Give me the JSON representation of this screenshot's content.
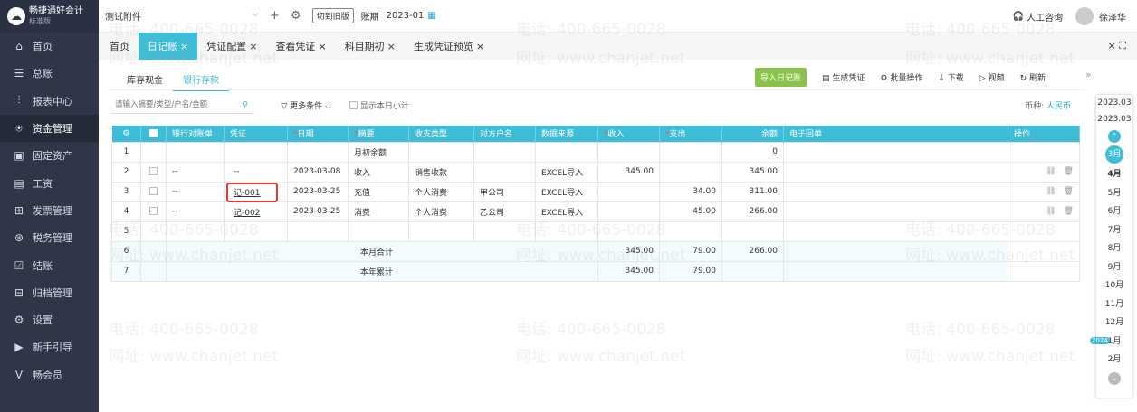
{
  "logo": {
    "title": "畅捷通好会计",
    "subtitle": "标准版"
  },
  "sidebar": {
    "items": [
      {
        "label": "首页",
        "icon": "home-icon"
      },
      {
        "label": "总账",
        "icon": "ledger-icon"
      },
      {
        "label": "报表中心",
        "icon": "chart-icon"
      },
      {
        "label": "资金管理",
        "icon": "money-bag-icon"
      },
      {
        "label": "固定资产",
        "icon": "asset-icon"
      },
      {
        "label": "工资",
        "icon": "salary-icon"
      },
      {
        "label": "发票管理",
        "icon": "invoice-icon"
      },
      {
        "label": "税务管理",
        "icon": "tax-icon"
      },
      {
        "label": "结账",
        "icon": "close-books-icon"
      },
      {
        "label": "归档管理",
        "icon": "archive-icon"
      },
      {
        "label": "设置",
        "icon": "gear-icon"
      },
      {
        "label": "新手引导",
        "icon": "guide-icon"
      },
      {
        "label": "畅会员",
        "icon": "vip-icon"
      }
    ]
  },
  "topbar": {
    "account": "测试附件",
    "switch_label": "切到旧版",
    "period_label": "账期",
    "period_value": "2023-01",
    "support": "人工咨询",
    "username": "徐泽华"
  },
  "tabs": [
    {
      "label": "首页"
    },
    {
      "label": "日记账"
    },
    {
      "label": "凭证配置"
    },
    {
      "label": "查看凭证"
    },
    {
      "label": "科目期初"
    },
    {
      "label": "生成凭证预览"
    }
  ],
  "tab_close": "×",
  "tabs_right": "×  ⛶",
  "subtabs": [
    "库存现金",
    "银行存款"
  ],
  "actions": {
    "import": "导入日记账",
    "generate": "生成凭证",
    "batch": "批量操作",
    "download": "下载",
    "video": "视频",
    "refresh": "刷新"
  },
  "filter": {
    "search_placeholder": "请输入摘要/类型/户名/金额",
    "more": "更多条件",
    "show_subtotal": "显示本日小计",
    "currency_label": "币种:",
    "currency_value": "人民币"
  },
  "table": {
    "headers": [
      "银行对账单",
      "凭证",
      "日期",
      "摘要",
      "收支类型",
      "对方户名",
      "数据来源",
      "收入",
      "支出",
      "余额",
      "电子回单",
      "操作"
    ],
    "rows": [
      {
        "no": "1",
        "bank": "",
        "voucher": "",
        "date": "",
        "summary": "月初余额",
        "type": "",
        "counter": "",
        "source": "",
        "income": "",
        "expense": "",
        "balance": "0"
      },
      {
        "no": "2",
        "bank": "--",
        "voucher": "--",
        "date": "2023-03-08",
        "summary": "收入",
        "type": "销售收款",
        "counter": "",
        "source": "EXCEL导入",
        "income": "345.00",
        "expense": "",
        "balance": "345.00"
      },
      {
        "no": "3",
        "bank": "--",
        "voucher": "记-001",
        "date": "2023-03-25",
        "summary": "充值",
        "type": "个人消费",
        "counter": "甲公司",
        "source": "EXCEL导入",
        "income": "",
        "expense": "34.00",
        "balance": "311.00"
      },
      {
        "no": "4",
        "bank": "--",
        "voucher": "记-002",
        "date": "2023-03-25",
        "summary": "消费",
        "type": "个人消费",
        "counter": "乙公司",
        "source": "EXCEL导入",
        "income": "",
        "expense": "45.00",
        "balance": "266.00"
      },
      {
        "no": "5",
        "bank": "",
        "voucher": "",
        "date": "",
        "summary": "",
        "type": "",
        "counter": "",
        "source": "",
        "income": "",
        "expense": "",
        "balance": ""
      }
    ],
    "month_total": {
      "no": "6",
      "label": "本月合计",
      "income": "345.00",
      "expense": "79.00",
      "balance": "266.00"
    },
    "year_total": {
      "no": "7",
      "label": "本年累计",
      "income": "345.00",
      "expense": "79.00"
    }
  },
  "watermark": {
    "phone": "电话: 400-665-0028",
    "site": "网址: www.chanjet.net"
  },
  "month_panel": {
    "years": [
      "2023.03",
      "2023.03"
    ],
    "months": [
      "3月",
      "4月",
      "5月",
      "6月",
      "7月",
      "8月",
      "9月",
      "10月",
      "11月",
      "12月",
      "1月",
      "2月"
    ],
    "year_badge": "2024",
    "active_month": "3月"
  },
  "colors": {
    "accent": "#3fbcd6",
    "sidebar": "#2e3648",
    "import_btn": "#8bc34a",
    "highlight": "#e53935"
  }
}
